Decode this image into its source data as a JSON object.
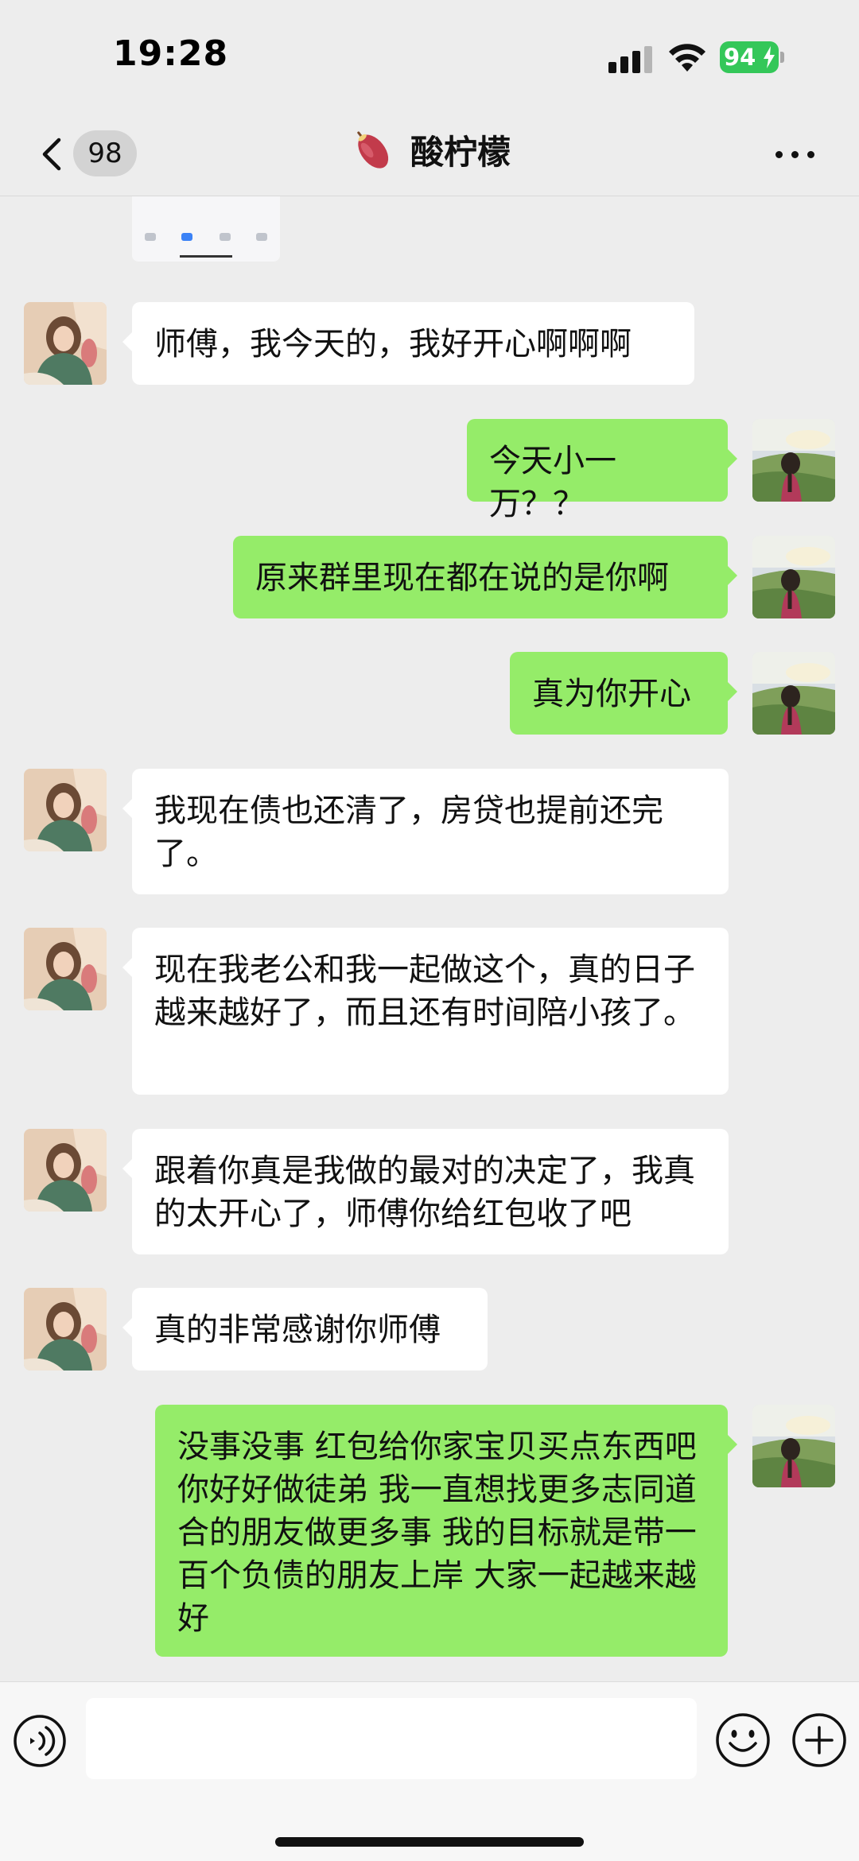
{
  "status_bar": {
    "time": "19:28",
    "battery": "94",
    "icons": [
      "cellular-signal-icon",
      "wifi-icon",
      "battery-charging-icon"
    ]
  },
  "nav": {
    "back_icon": "chevron-left-icon",
    "unread_count": "98",
    "title_emoji": "sweet-potato-emoji",
    "title": "酸柠檬",
    "more_icon": "more-dots-icon"
  },
  "colors": {
    "background": "#ededed",
    "bubble_incoming": "#ffffff",
    "bubble_outgoing": "#95ec69"
  },
  "messages": [
    {
      "side": "left",
      "text": "师傅，我今天的，我好开心啊啊啊"
    },
    {
      "side": "right",
      "text": "今天小一万？？"
    },
    {
      "side": "right",
      "text": "原来群里现在都在说的是你啊"
    },
    {
      "side": "right",
      "text": "真为你开心"
    },
    {
      "side": "left",
      "text": "我现在债也还清了，房贷也提前还完了。"
    },
    {
      "side": "left",
      "text": "现在我老公和我一起做这个，真的日子越来越好了，而且还有时间陪小孩了。"
    },
    {
      "side": "left",
      "text": "跟着你真是我做的最对的决定了，我真的太开心了，师傅你给红包收了吧"
    },
    {
      "side": "left",
      "text": "真的非常感谢你师傅"
    },
    {
      "side": "right",
      "text": "没事没事 红包给你家宝贝买点东西吧你好好做徒弟 我一直想找更多志同道合的朋友做更多事 我的目标就是带一百个负债的朋友上岸 大家一起越来越好"
    }
  ],
  "input_bar": {
    "icons": [
      "voice-icon",
      "emoji-icon",
      "add-icon"
    ]
  }
}
